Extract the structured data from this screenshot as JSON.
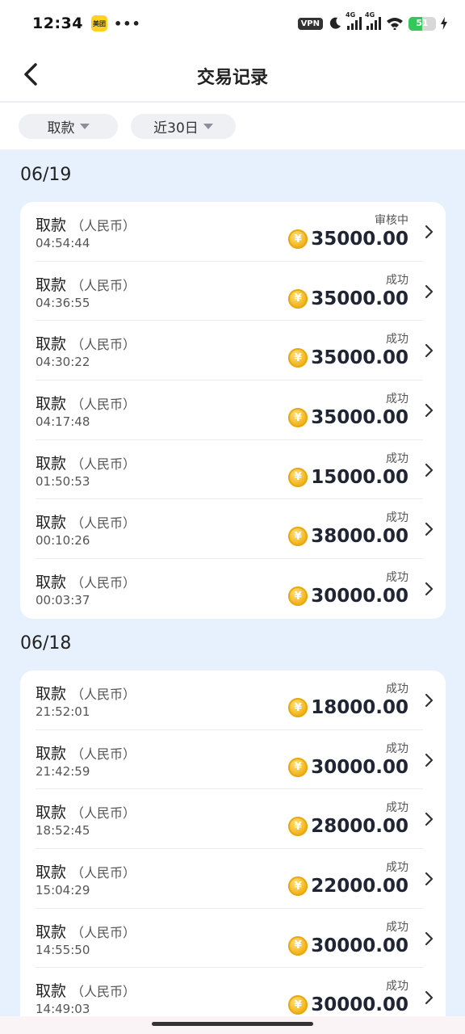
{
  "status_bar": {
    "time": "12:34",
    "app_icon_text": "美团",
    "dots": "•••",
    "vpn": "VPN",
    "net1": "4G",
    "net2": "4G",
    "battery": "51"
  },
  "header": {
    "title": "交易记录",
    "back_icon": "chevron-left-icon"
  },
  "filters": {
    "type": "取款",
    "range": "近30日"
  },
  "sections": [
    {
      "date": "06/19",
      "rows": [
        {
          "title": "取款",
          "currency": "（人民币）",
          "time": "04:54:44",
          "status": "审核中",
          "amount": "35000.00"
        },
        {
          "title": "取款",
          "currency": "（人民币）",
          "time": "04:36:55",
          "status": "成功",
          "amount": "35000.00"
        },
        {
          "title": "取款",
          "currency": "（人民币）",
          "time": "04:30:22",
          "status": "成功",
          "amount": "35000.00"
        },
        {
          "title": "取款",
          "currency": "（人民币）",
          "time": "04:17:48",
          "status": "成功",
          "amount": "35000.00"
        },
        {
          "title": "取款",
          "currency": "（人民币）",
          "time": "01:50:53",
          "status": "成功",
          "amount": "15000.00"
        },
        {
          "title": "取款",
          "currency": "（人民币）",
          "time": "00:10:26",
          "status": "成功",
          "amount": "38000.00"
        },
        {
          "title": "取款",
          "currency": "（人民币）",
          "time": "00:03:37",
          "status": "成功",
          "amount": "30000.00"
        }
      ]
    },
    {
      "date": "06/18",
      "rows": [
        {
          "title": "取款",
          "currency": "（人民币）",
          "time": "21:52:01",
          "status": "成功",
          "amount": "18000.00"
        },
        {
          "title": "取款",
          "currency": "（人民币）",
          "time": "21:42:59",
          "status": "成功",
          "amount": "30000.00"
        },
        {
          "title": "取款",
          "currency": "（人民币）",
          "time": "18:52:45",
          "status": "成功",
          "amount": "28000.00"
        },
        {
          "title": "取款",
          "currency": "（人民币）",
          "time": "15:04:29",
          "status": "成功",
          "amount": "22000.00"
        },
        {
          "title": "取款",
          "currency": "（人民币）",
          "time": "14:55:50",
          "status": "成功",
          "amount": "30000.00"
        },
        {
          "title": "取款",
          "currency": "（人民币）",
          "time": "14:49:03",
          "status": "成功",
          "amount": "30000.00"
        }
      ]
    }
  ],
  "coin_symbol": "¥",
  "colors": {
    "page_bg": "#e6f1fd",
    "coin": "#f2b51c",
    "battery": "#34c759"
  }
}
